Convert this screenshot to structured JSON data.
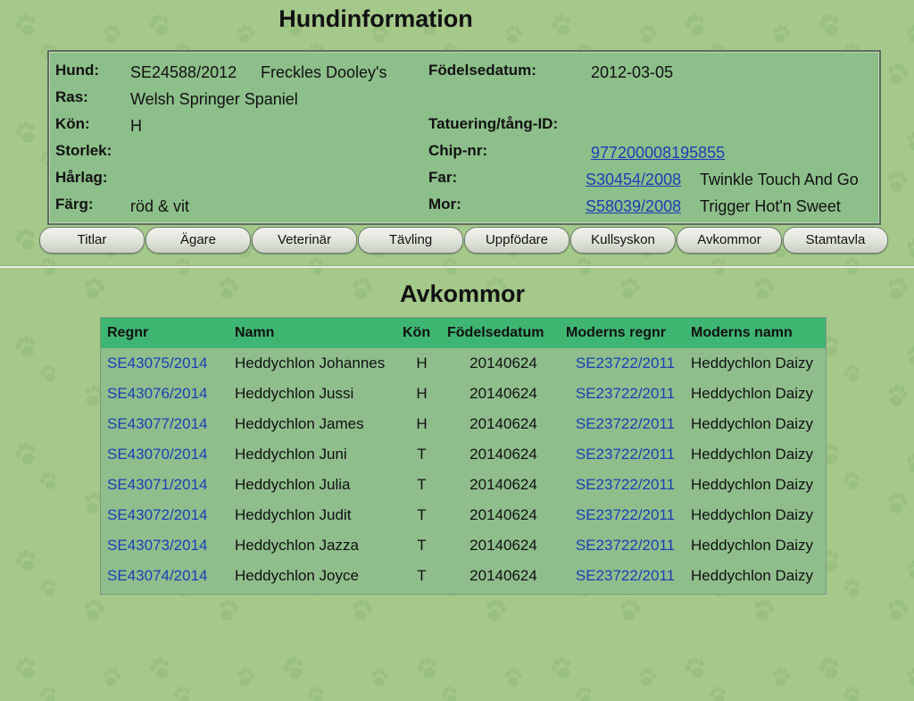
{
  "page": {
    "title": "Hundinformation",
    "section_title": "Avkommor"
  },
  "dog": {
    "hund_label": "Hund:",
    "regnr": "SE24588/2012",
    "name": "Freckles Dooley's",
    "ras_label": "Ras:",
    "ras": "Welsh Springer Spaniel",
    "kon_label": "Kön:",
    "kon": "H",
    "storlek_label": "Storlek:",
    "storlek": "",
    "harlag_label": "Hårlag:",
    "harlag": "",
    "farg_label": "Färg:",
    "farg": "röd & vit",
    "fodelsedatum_label": "Födelsedatum:",
    "fodelsedatum": "2012-03-05",
    "tatuering_label": "Tatuering/tång-ID:",
    "tatuering": "",
    "chip_label": "Chip-nr:",
    "chip": "977200008195855",
    "far_label": "Far:",
    "far_regnr": "S30454/2008",
    "far_name": "Twinkle Touch And Go",
    "mor_label": "Mor:",
    "mor_regnr": "S58039/2008",
    "mor_name": "Trigger Hot'n Sweet"
  },
  "nav": {
    "tabs": [
      {
        "label": "Titlar"
      },
      {
        "label": "Ägare"
      },
      {
        "label": "Veterinär"
      },
      {
        "label": "Tävling"
      },
      {
        "label": "Uppfödare"
      },
      {
        "label": "Kullsyskon"
      },
      {
        "label": "Avkommor"
      },
      {
        "label": "Stamtavla"
      }
    ]
  },
  "table": {
    "headers": {
      "regnr": "Regnr",
      "namn": "Namn",
      "kon": "Kön",
      "fodelsedatum": "Födelsedatum",
      "moderns_regnr": "Moderns regnr",
      "moderns_namn": "Moderns namn"
    },
    "rows": [
      {
        "regnr": "SE43075/2014",
        "namn": "Heddychlon Johannes",
        "kon": "H",
        "fod": "20140624",
        "mregnr": "SE23722/2011",
        "mnamn": "Heddychlon Daizy"
      },
      {
        "regnr": "SE43076/2014",
        "namn": "Heddychlon Jussi",
        "kon": "H",
        "fod": "20140624",
        "mregnr": "SE23722/2011",
        "mnamn": "Heddychlon Daizy"
      },
      {
        "regnr": "SE43077/2014",
        "namn": "Heddychlon James",
        "kon": "H",
        "fod": "20140624",
        "mregnr": "SE23722/2011",
        "mnamn": "Heddychlon Daizy"
      },
      {
        "regnr": "SE43070/2014",
        "namn": "Heddychlon Juni",
        "kon": "T",
        "fod": "20140624",
        "mregnr": "SE23722/2011",
        "mnamn": "Heddychlon Daizy"
      },
      {
        "regnr": "SE43071/2014",
        "namn": "Heddychlon Julia",
        "kon": "T",
        "fod": "20140624",
        "mregnr": "SE23722/2011",
        "mnamn": "Heddychlon Daizy"
      },
      {
        "regnr": "SE43072/2014",
        "namn": "Heddychlon Judit",
        "kon": "T",
        "fod": "20140624",
        "mregnr": "SE23722/2011",
        "mnamn": "Heddychlon Daizy"
      },
      {
        "regnr": "SE43073/2014",
        "namn": "Heddychlon Jazza",
        "kon": "T",
        "fod": "20140624",
        "mregnr": "SE23722/2011",
        "mnamn": "Heddychlon Daizy"
      },
      {
        "regnr": "SE43074/2014",
        "namn": "Heddychlon Joyce",
        "kon": "T",
        "fod": "20140624",
        "mregnr": "SE23722/2011",
        "mnamn": "Heddychlon Daizy"
      }
    ]
  },
  "colors": {
    "background": "#a4c98a",
    "info_box": "#8dbf8a",
    "table_header": "#3fb572",
    "link": "#1a3fb5"
  }
}
